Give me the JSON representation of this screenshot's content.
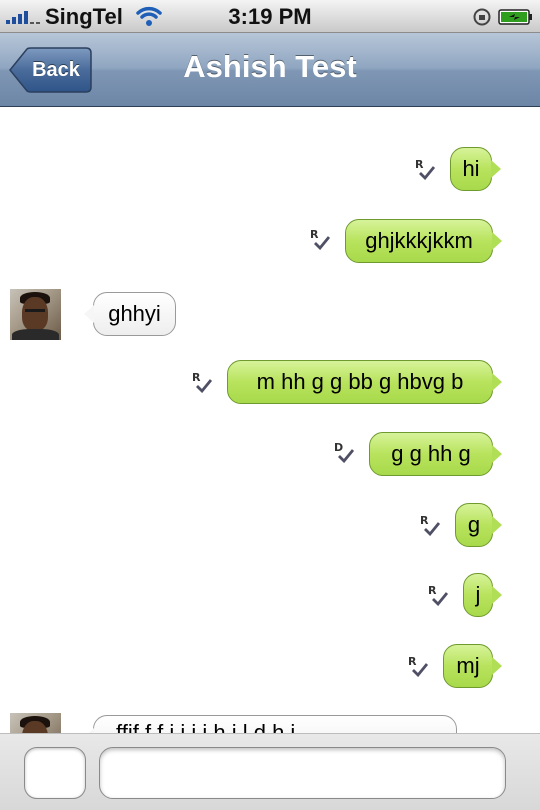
{
  "status_bar": {
    "carrier": "SingTel",
    "time": "3:19 PM"
  },
  "nav": {
    "back_label": "Back",
    "title": "Ashish Test"
  },
  "messages": [
    {
      "type": "received",
      "text": ""
    },
    {
      "type": "sent",
      "text": "hi",
      "status": "R"
    },
    {
      "type": "sent",
      "text": "ghjkkkjkkm",
      "status": "R"
    },
    {
      "type": "received",
      "text": "ghhyi"
    },
    {
      "type": "sent",
      "text": "m hh g g bb g hbvg b",
      "status": "R"
    },
    {
      "type": "sent",
      "text": "g g hh g",
      "status": "D"
    },
    {
      "type": "sent",
      "text": "g",
      "status": "R"
    },
    {
      "type": "sent",
      "text": "j",
      "status": "R"
    },
    {
      "type": "sent",
      "text": "mj",
      "status": "R"
    },
    {
      "type": "received",
      "text": "ffif  f f j    j  i  j  h  i  l   d  h  i"
    }
  ],
  "composer": {
    "value": "",
    "placeholder": ""
  },
  "colors": {
    "sent_bubble": "#b8e35d",
    "received_bubble": "#ffffff",
    "nav_bar": "#7f97b4"
  },
  "icons": {
    "wifi": "wifi-icon",
    "lock": "rotation-lock-icon",
    "battery": "battery-charging-icon",
    "status": "check-icon"
  }
}
